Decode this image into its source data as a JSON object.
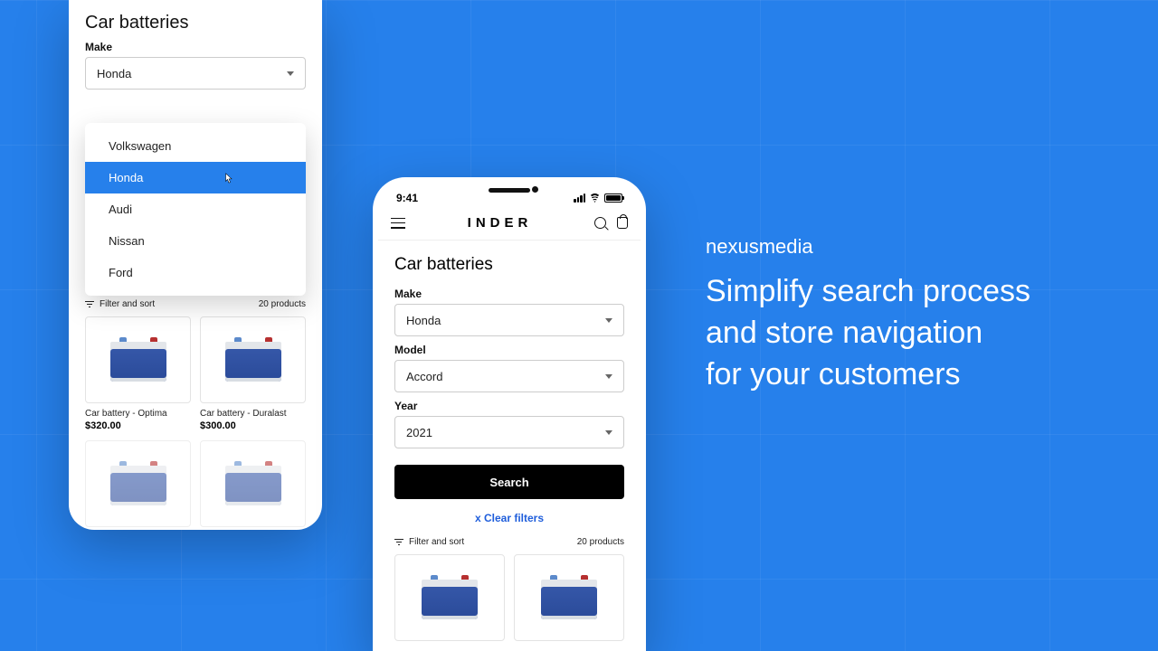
{
  "phone1": {
    "title": "Car batteries",
    "make_label": "Make",
    "make_value": "Honda",
    "options": [
      "Volkswagen",
      "Honda",
      "Audi",
      "Nissan",
      "Ford"
    ],
    "selected_index": 1,
    "clear": "x Clear filters",
    "filter_sort": "Filter and sort",
    "count": "20 products",
    "products": [
      {
        "name": "Car battery - Optima",
        "price": "$320.00"
      },
      {
        "name": "Car battery - Duralast",
        "price": "$300.00"
      }
    ]
  },
  "phone2": {
    "time": "9:41",
    "brand": "INDER",
    "title": "Car batteries",
    "make_label": "Make",
    "make_value": "Honda",
    "model_label": "Model",
    "model_value": "Accord",
    "year_label": "Year",
    "year_value": "2021",
    "search": "Search",
    "clear": "x Clear filters",
    "filter_sort": "Filter and sort",
    "count": "20 products"
  },
  "copy": {
    "logo": "nexusmedia",
    "line1": "Simplify search process",
    "line2": "and store navigation",
    "line3": "for your customers"
  }
}
